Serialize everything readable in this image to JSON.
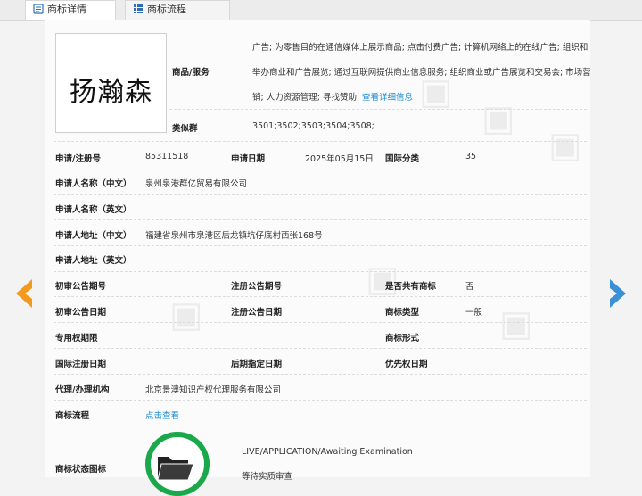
{
  "tabs": [
    {
      "label": "商标详情",
      "icon": "document-icon"
    },
    {
      "label": "商标流程",
      "icon": "list-icon"
    }
  ],
  "trademark": {
    "logo_text": "扬瀚森",
    "goods_label": "商品/服务",
    "goods_text": "广告; 为零售目的在通信媒体上展示商品; 点击付费广告; 计算机网络上的在线广告; 组织和举办商业和广告展览; 通过互联网提供商业信息服务; 组织商业或广告展览和交易会; 市场营销; 人力资源管理; 寻找赞助",
    "goods_link": "查看详细信息",
    "similar_label": "类似群",
    "similar_value": "3501;3502;3503;3504;3508;"
  },
  "fields": {
    "reg_no_label": "申请/注册号",
    "reg_no": "85311518",
    "app_date_label": "申请日期",
    "app_date": "2025年05月15日",
    "intl_class_label": "国际分类",
    "intl_class": "35",
    "applicant_cn_label": "申请人名称（中文）",
    "applicant_cn": "泉州泉港群亿贸易有限公司",
    "applicant_en_label": "申请人名称（英文）",
    "address_cn_label": "申请人地址（中文）",
    "address_cn": "福建省泉州市泉港区后龙镇坑仔底村西张168号",
    "address_en_label": "申请人地址（英文）",
    "prelim_no_label": "初审公告期号",
    "reg_pub_no_label": "注册公告期号",
    "shared_label": "是否共有商标",
    "shared": "否",
    "prelim_date_label": "初审公告日期",
    "reg_pub_date_label": "注册公告日期",
    "mark_type_label": "商标类型",
    "mark_type": "一般",
    "exclusive_label": "专用权期限",
    "mark_form_label": "商标形式",
    "intl_reg_date_label": "国际注册日期",
    "later_date_label": "后期指定日期",
    "priority_date_label": "优先权日期",
    "agent_label": "代理/办理机构",
    "agent": "北京景澳知识产权代理服务有限公司",
    "flow_label": "商标流程",
    "flow_link": "点击查看",
    "status_label": "商标状态图标",
    "status_en": "LIVE/APPLICATION/Awaiting Examination",
    "status_cn": "等待实质审查"
  },
  "colors": {
    "link": "#1a8ad6",
    "arrow_left": "#f39a1e",
    "arrow_right": "#3a8fd6",
    "status": "#1aa84a"
  },
  "nav": {
    "prev": "chevron-left-icon",
    "next": "chevron-right-icon"
  }
}
